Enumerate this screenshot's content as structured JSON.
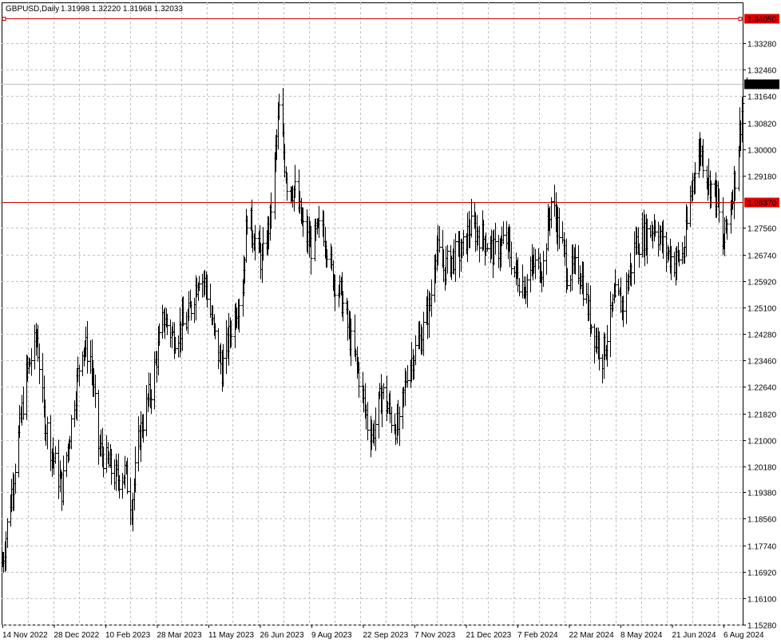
{
  "window": {
    "symbol": "GBPUSD,Daily",
    "ohlc_text": "1.31998 1.32220 1.31968 1.32033"
  },
  "colors": {
    "background": "#ffffff",
    "grid": "#c0c0c0",
    "bars": "#000000",
    "level_line": "#cc0000",
    "label_red_bg": "#e00000",
    "current_label_bg": "#000000",
    "current_line": "#c0c0c0"
  },
  "chart_data": {
    "type": "ohlc",
    "title": "GBPUSD,Daily",
    "ohlc_last": {
      "open": 1.31998,
      "high": 1.3222,
      "low": 1.31968,
      "close": 1.32033
    },
    "ylim": [
      1.1528,
      1.3405
    ],
    "y_ticks": [
      "1.33280",
      "1.32460",
      "1.31640",
      "1.30820",
      "1.30000",
      "1.29180",
      "1.27560",
      "1.26740",
      "1.25920",
      "1.25100",
      "1.24280",
      "1.23460",
      "1.22640",
      "1.21820",
      "1.21000",
      "1.20180",
      "1.19380",
      "1.18560",
      "1.17740",
      "1.16920",
      "1.16100",
      "1.15280"
    ],
    "x_tick_labels": [
      "14 Nov 2022",
      "28 Dec 2022",
      "10 Feb 2023",
      "28 Mar 2023",
      "11 May 2023",
      "26 Jun 2023",
      "9 Aug 2023",
      "22 Sep 2023",
      "7 Nov 2023",
      "21 Dec 2023",
      "7 Feb 2024",
      "22 Mar 2024",
      "8 May 2024",
      "21 Jun 2024",
      "6 Aug 2024"
    ],
    "horizontal_levels": [
      {
        "value": 1.3405,
        "label": "1.34050",
        "style": "red"
      },
      {
        "value": 1.2837,
        "label": "1.28370",
        "style": "red"
      }
    ],
    "current_price": {
      "value": 1.32033,
      "label": "1.32033"
    },
    "anchors": [
      [
        "2022-11-14",
        1.172
      ],
      [
        "2022-11-24",
        1.2
      ],
      [
        "2022-12-05",
        1.23
      ],
      [
        "2022-12-14",
        1.242
      ],
      [
        "2022-12-20",
        1.218
      ],
      [
        "2022-12-28",
        1.205
      ],
      [
        "2023-01-05",
        1.195
      ],
      [
        "2023-01-12",
        1.213
      ],
      [
        "2023-01-23",
        1.24
      ],
      [
        "2023-01-30",
        1.236
      ],
      [
        "2023-02-06",
        1.208
      ],
      [
        "2023-02-15",
        1.202
      ],
      [
        "2023-02-22",
        1.198
      ],
      [
        "2023-03-01",
        1.2
      ],
      [
        "2023-03-07",
        1.19
      ],
      [
        "2023-03-14",
        1.212
      ],
      [
        "2023-03-24",
        1.226
      ],
      [
        "2023-04-04",
        1.248
      ],
      [
        "2023-04-12",
        1.242
      ],
      [
        "2023-04-25",
        1.247
      ],
      [
        "2023-05-05",
        1.262
      ],
      [
        "2023-05-11",
        1.258
      ],
      [
        "2023-05-18",
        1.243
      ],
      [
        "2023-05-25",
        1.232
      ],
      [
        "2023-06-02",
        1.245
      ],
      [
        "2023-06-12",
        1.258
      ],
      [
        "2023-06-16",
        1.28
      ],
      [
        "2023-06-23",
        1.272
      ],
      [
        "2023-06-29",
        1.265
      ],
      [
        "2023-07-06",
        1.278
      ],
      [
        "2023-07-14",
        1.312
      ],
      [
        "2023-07-21",
        1.29
      ],
      [
        "2023-07-28",
        1.287
      ],
      [
        "2023-08-04",
        1.275
      ],
      [
        "2023-08-11",
        1.27
      ],
      [
        "2023-08-21",
        1.277
      ],
      [
        "2023-08-29",
        1.262
      ],
      [
        "2023-09-06",
        1.255
      ],
      [
        "2023-09-15",
        1.24
      ],
      [
        "2023-09-22",
        1.23
      ],
      [
        "2023-09-29",
        1.215
      ],
      [
        "2023-10-04",
        1.212
      ],
      [
        "2023-10-12",
        1.225
      ],
      [
        "2023-10-20",
        1.217
      ],
      [
        "2023-10-27",
        1.213
      ],
      [
        "2023-11-03",
        1.232
      ],
      [
        "2023-11-15",
        1.242
      ],
      [
        "2023-11-23",
        1.252
      ],
      [
        "2023-11-28",
        1.27
      ],
      [
        "2023-12-05",
        1.263
      ],
      [
        "2023-12-14",
        1.267
      ],
      [
        "2023-12-21",
        1.268
      ],
      [
        "2023-12-28",
        1.276
      ],
      [
        "2024-01-08",
        1.273
      ],
      [
        "2024-01-18",
        1.268
      ],
      [
        "2024-01-29",
        1.272
      ],
      [
        "2024-02-05",
        1.262
      ],
      [
        "2024-02-14",
        1.258
      ],
      [
        "2024-02-22",
        1.264
      ],
      [
        "2024-03-01",
        1.264
      ],
      [
        "2024-03-08",
        1.284
      ],
      [
        "2024-03-15",
        1.275
      ],
      [
        "2024-03-22",
        1.262
      ],
      [
        "2024-04-02",
        1.263
      ],
      [
        "2024-04-12",
        1.246
      ],
      [
        "2024-04-22",
        1.236
      ],
      [
        "2024-05-03",
        1.254
      ],
      [
        "2024-05-10",
        1.252
      ],
      [
        "2024-05-21",
        1.271
      ],
      [
        "2024-05-31",
        1.274
      ],
      [
        "2024-06-07",
        1.277
      ],
      [
        "2024-06-14",
        1.27
      ],
      [
        "2024-06-24",
        1.265
      ],
      [
        "2024-07-02",
        1.268
      ],
      [
        "2024-07-12",
        1.296
      ],
      [
        "2024-07-17",
        1.3
      ],
      [
        "2024-07-24",
        1.29
      ],
      [
        "2024-07-31",
        1.285
      ],
      [
        "2024-08-05",
        1.27
      ],
      [
        "2024-08-09",
        1.277
      ],
      [
        "2024-08-16",
        1.292
      ],
      [
        "2024-08-22",
        1.312
      ],
      [
        "2024-08-26",
        1.321
      ]
    ]
  }
}
